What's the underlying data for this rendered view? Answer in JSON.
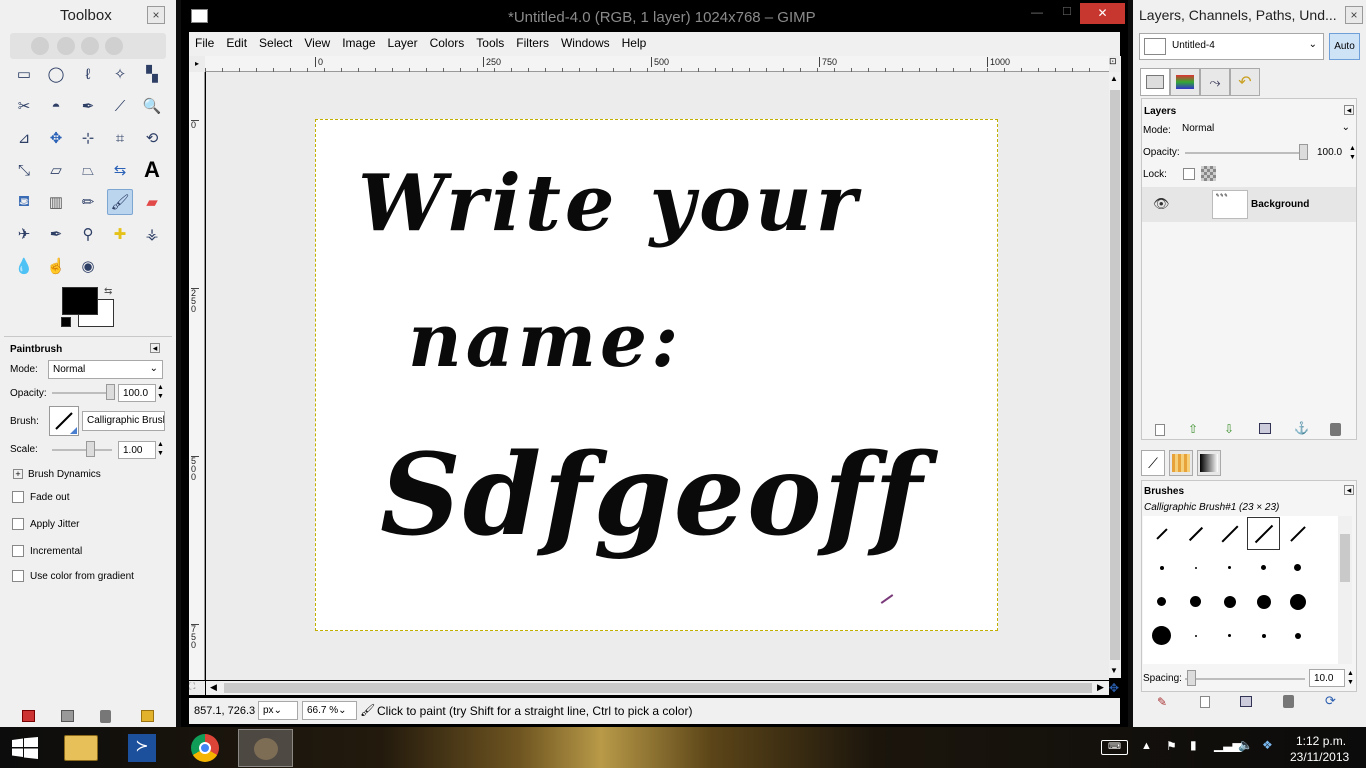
{
  "toolbox": {
    "title": "Toolbox",
    "close": "×",
    "tools": [
      "rect-select-icon",
      "ellipse-select-icon",
      "free-select-icon",
      "fuzzy-select-icon",
      "color-select-icon",
      "scissors-icon",
      "foreground-select-icon",
      "paths-icon",
      "color-picker-icon",
      "zoom-icon",
      "measure-icon",
      "move-icon",
      "align-icon",
      "crop-icon",
      "rotate-icon",
      "scale-icon",
      "shear-icon",
      "perspective-icon",
      "flip-icon",
      "text-icon",
      "bucket-fill-icon",
      "blend-icon",
      "pencil-icon",
      "paintbrush-icon",
      "eraser-icon",
      "airbrush-icon",
      "ink-icon",
      "clone-icon",
      "heal-icon",
      "perspective-clone-icon",
      "blur-icon",
      "smudge-icon",
      "dodge-burn-icon"
    ],
    "fg_color": "#000000",
    "bg_color": "#ffffff"
  },
  "tool_options": {
    "title": "Paintbrush",
    "mode_label": "Mode:",
    "mode_value": "Normal",
    "opacity_label": "Opacity:",
    "opacity_value": "100.0",
    "opacity_fraction": 1.0,
    "brush_label": "Brush:",
    "brush_value": "Calligraphic Brush",
    "scale_label": "Scale:",
    "scale_value": "1.00",
    "dynamics_label": "Brush Dynamics",
    "fade_out": "Fade out",
    "apply_jitter": "Apply Jitter",
    "incremental": "Incremental",
    "use_color_gradient": "Use color from gradient"
  },
  "window": {
    "title": "*Untitled-4.0 (RGB, 1 layer) 1024x768 – GIMP",
    "minimize": "—",
    "maximize": "□",
    "close": "✕"
  },
  "menu": [
    "File",
    "Edit",
    "Select",
    "View",
    "Image",
    "Layer",
    "Colors",
    "Tools",
    "Filters",
    "Windows",
    "Help"
  ],
  "ruler": {
    "h_ticks": [
      "0",
      "250",
      "500",
      "750",
      "1000"
    ],
    "v_ticks": [
      "0",
      "250",
      "500",
      "750"
    ]
  },
  "canvas_text": {
    "line1": "Write  your",
    "line2": "name:",
    "line3": "Sdfgeoff"
  },
  "status": {
    "coords": "857.1, 726.3",
    "unit": "px",
    "zoom": "66.7 %",
    "message": "Click to paint (try Shift for a straight line, Ctrl to pick a color)"
  },
  "right_panel": {
    "title": "Layers, Channels, Paths, Und...",
    "close": "×",
    "image_select": "Untitled-4",
    "auto": "Auto",
    "layers_title": "Layers",
    "mode_label": "Mode:",
    "mode_value": "Normal",
    "opacity_label": "Opacity:",
    "opacity_value": "100.0",
    "lock_label": "Lock:",
    "layer_name": "Background",
    "brushes_title": "Brushes",
    "brush_name": "Calligraphic Brush#1 (23 × 23)",
    "spacing_label": "Spacing:",
    "spacing_value": "10.0"
  },
  "taskbar": {
    "time": "1:12 p.m.",
    "date": "23/11/2013"
  }
}
